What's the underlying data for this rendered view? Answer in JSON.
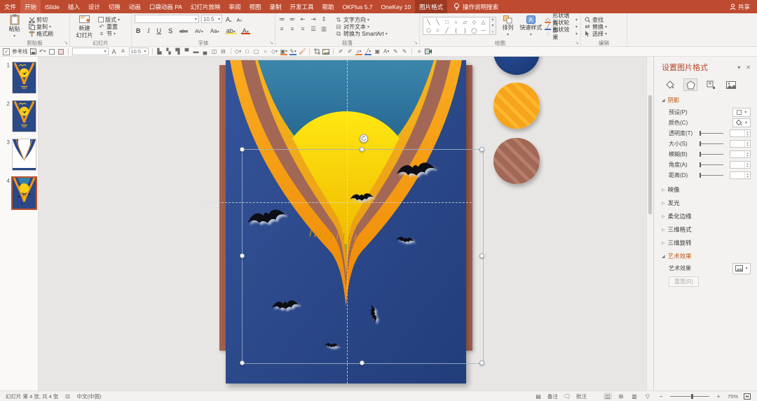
{
  "titlebar": {
    "tabs": [
      "文件",
      "开始",
      "iSlide",
      "插入",
      "设计",
      "切换",
      "动画",
      "口袋动画 PA",
      "幻灯片放映",
      "审阅",
      "视图",
      "录制",
      "开发工具",
      "帮助",
      "OKPlus 5.7",
      "OneKey 10",
      "图片格式"
    ],
    "search_label": "操作说明搜索",
    "share_label": "共享"
  },
  "ribbon": {
    "clipboard": {
      "group_label": "剪贴板",
      "paste": "粘贴",
      "cut": "剪切",
      "copy": "复制",
      "format_painter": "格式刷"
    },
    "slides": {
      "group_label": "幻灯片",
      "new_slide_line1": "新建",
      "new_slide_line2": "幻灯片",
      "layout": "版式",
      "reset": "重置",
      "section": "节"
    },
    "font": {
      "group_label": "字体",
      "font_size": "10.5",
      "bold": "B",
      "italic": "I",
      "underline": "U",
      "shadow": "S",
      "strike": "abc",
      "spacing": "AV",
      "case": "Aa"
    },
    "paragraph": {
      "group_label": "段落",
      "text_direction": "文字方向",
      "align_text": "对齐文本",
      "convert_smartart": "转换为 SmartArt"
    },
    "drawing": {
      "group_label": "绘图",
      "arrange": "排列",
      "quick_styles": "快速样式",
      "shape_fill": "形状填充",
      "shape_outline": "形状轮廓",
      "shape_effects": "形状效果"
    },
    "editing": {
      "group_label": "编辑",
      "find": "查找",
      "replace": "替换",
      "select": "选择"
    }
  },
  "toolbar": {
    "guides_label": "参考线",
    "font_size": "10.5"
  },
  "slides_panel": {
    "slides": [
      "1",
      "2",
      "3",
      "4"
    ],
    "selected_slide": "4"
  },
  "format_panel": {
    "title": "设置图片格式",
    "shadow_section": {
      "title": "阴影",
      "preset_label": "预设(P)",
      "color_label": "颜色(C)",
      "transparency_label": "透明度(T)",
      "size_label": "大小(S)",
      "blur_label": "模糊(B)",
      "angle_label": "角度(A)",
      "distance_label": "距离(D)"
    },
    "sections": [
      "映像",
      "发光",
      "柔化边缘",
      "三维格式",
      "三维旋转"
    ],
    "artistic_section": {
      "title": "艺术效果",
      "effect_label": "艺术效果",
      "reset_label": "重置(R)"
    }
  },
  "statusbar": {
    "slide_info": "幻灯片 第 4 张, 共 4 张",
    "language": "中文(中国)",
    "notes_label": "备注",
    "comments_label": "批注",
    "zoom_level": "75%"
  },
  "colors": {
    "titlebar_red": "#BE4B30",
    "contextual_tab_dark": "#9E3A22",
    "slide_blue": "#2C4A8C",
    "teal": "#2F7FA8",
    "sun_yellow": "#FFDD00",
    "orange": "#F7A51C",
    "mauve": "#A26855",
    "accent_section": "#C45911",
    "canvas_gray": "#E8E6E4"
  }
}
